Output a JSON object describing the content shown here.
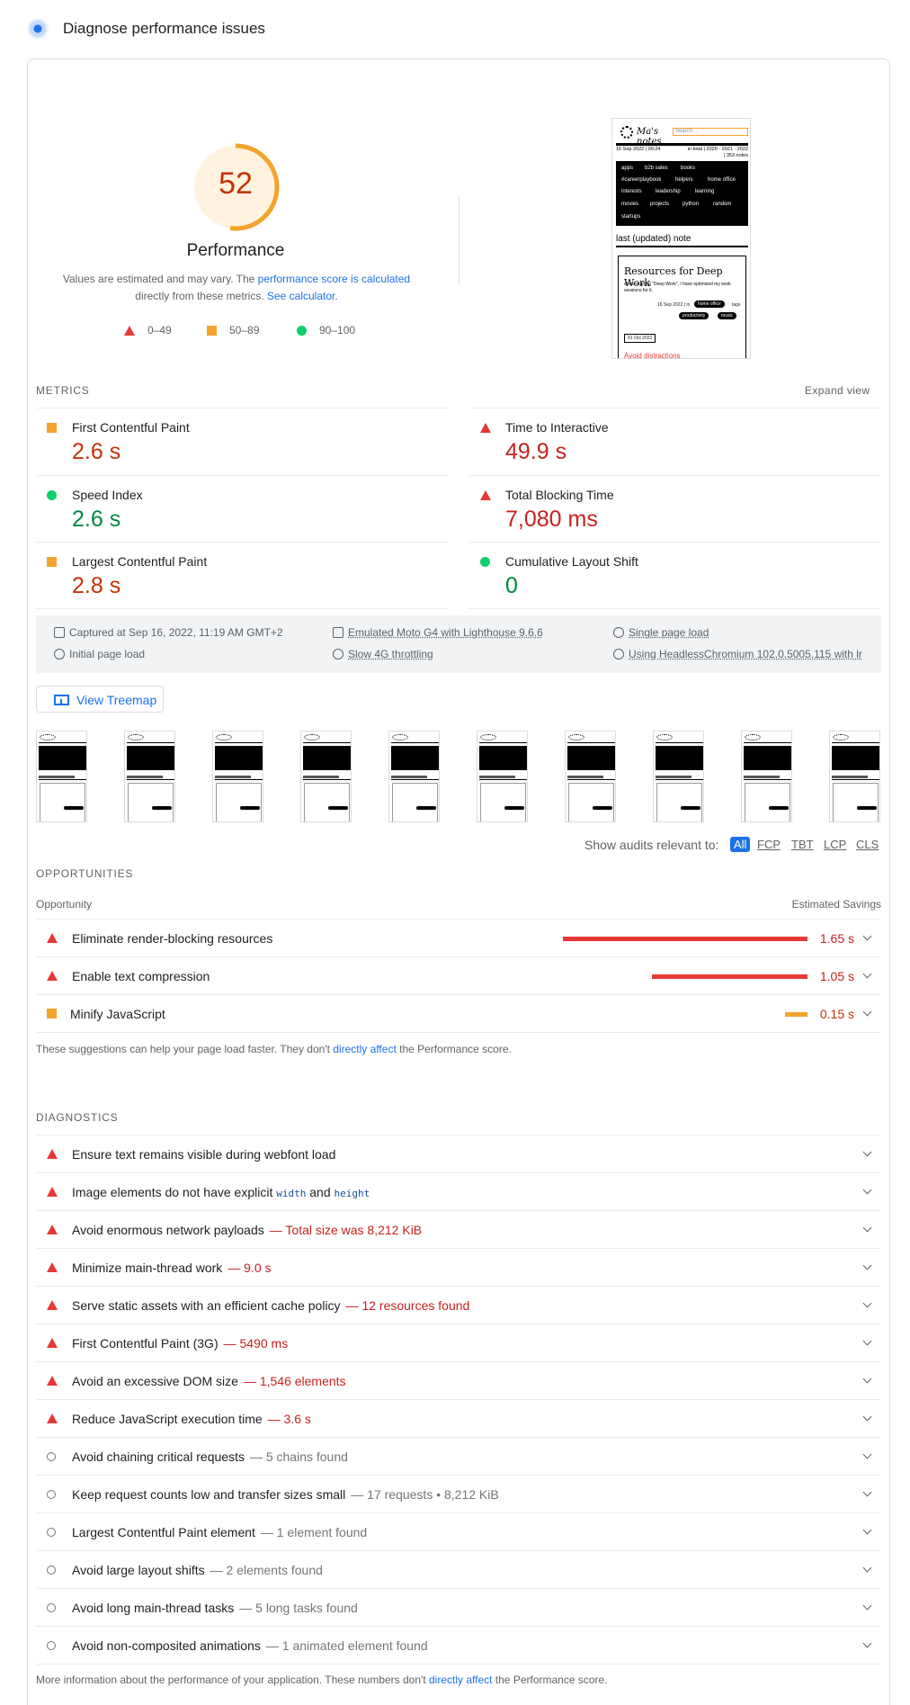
{
  "header": {
    "title": "Diagnose performance issues"
  },
  "score": {
    "value": 52,
    "fraction": 0.52,
    "label": "Performance",
    "color": "#c33300",
    "arc_color": "#f4a32d"
  },
  "description": {
    "prefix": "Values are estimated and may vary. The ",
    "link1": "performance score is calculated",
    "middle": " directly from these metrics. ",
    "link2": "See calculator."
  },
  "legend": [
    {
      "shape": "triangle",
      "color": "#e53935",
      "label": "0–49"
    },
    {
      "shape": "square",
      "color": "#f4a32d",
      "label": "50–89"
    },
    {
      "shape": "circle",
      "color": "#0cce6b",
      "label": "90–100"
    }
  ],
  "screenshot": {
    "search_placeholder": "Search...",
    "date_left": "16 Sep 2022 | 09:24",
    "date_right": "in total | 2020 · 2021 · 2022",
    "date_right2": "| 353 notes",
    "nav": [
      "apps",
      "b2b sales",
      "books",
      "#careerplaybook",
      "helpers",
      "home office",
      "interests",
      "leadership",
      "learning",
      "movies",
      "projects",
      "python",
      "random",
      "startups"
    ],
    "section": "last (updated) note",
    "article_title": "Resources for Deep Work",
    "article_text": "since reading \"Deep Work\", I have optimized my work sessions for it.",
    "article_date": "16 Sep 2022 | in",
    "tag1": "home office",
    "tags_label": "tags",
    "tag2": "productivity",
    "tag3": "music",
    "datebox": "01 Oct 2022",
    "red_text": "Avoid distractions"
  },
  "metrics_section": {
    "title": "METRICS",
    "expand": "Expand view"
  },
  "metrics": [
    {
      "name": "First Contentful Paint",
      "value": "2.6 s",
      "rating": "average",
      "color": "#c33300"
    },
    {
      "name": "Time to Interactive",
      "value": "49.9 s",
      "rating": "fail",
      "color": "#c5221f"
    },
    {
      "name": "Speed Index",
      "value": "2.6 s",
      "rating": "pass",
      "color": "#018642"
    },
    {
      "name": "Total Blocking Time",
      "value": "7,080 ms",
      "rating": "fail",
      "color": "#c5221f"
    },
    {
      "name": "Largest Contentful Paint",
      "value": "2.8 s",
      "rating": "average",
      "color": "#c33300"
    },
    {
      "name": "Cumulative Layout Shift",
      "value": "0",
      "rating": "pass",
      "color": "#018642"
    }
  ],
  "info": {
    "captured": "Captured at Sep 16, 2022, 11:19 AM GMT+2",
    "device": "Emulated Moto G4 with Lighthouse 9.6.6",
    "load": "Single page load",
    "initial": "Initial page load",
    "throttling": "Slow 4G throttling",
    "browser": "Using HeadlessChromium 102.0.5005.115 with lr"
  },
  "treemap": {
    "label": "View Treemap"
  },
  "filter": {
    "label": "Show audits relevant to:",
    "chips": [
      "All",
      "FCP",
      "TBT",
      "LCP",
      "CLS"
    ]
  },
  "opportunities": {
    "title": "OPPORTUNITIES",
    "col_left": "Opportunity",
    "col_right": "Estimated Savings",
    "items": [
      {
        "name": "Eliminate render-blocking resources",
        "savings": "1.65 s",
        "savings_s": 1.65,
        "rating": "fail"
      },
      {
        "name": "Enable text compression",
        "savings": "1.05 s",
        "savings_s": 1.05,
        "rating": "fail"
      },
      {
        "name": "Minify JavaScript",
        "savings": "0.15 s",
        "savings_s": 0.15,
        "rating": "average"
      }
    ],
    "note_prefix": "These suggestions can help your page load faster. They don't ",
    "note_link": "directly affect",
    "note_suffix": " the Performance score."
  },
  "diagnostics": {
    "title": "DIAGNOSTICS",
    "items": [
      {
        "name": "Ensure text remains visible during webfont load",
        "display": "",
        "rating": "fail"
      },
      {
        "name": "Image elements do not have explicit",
        "code1": "width",
        "and": "and",
        "code2": "height",
        "display": "",
        "rating": "fail"
      },
      {
        "name": "Avoid enormous network payloads",
        "display": "— Total size was 8,212 KiB",
        "rating": "fail"
      },
      {
        "name": "Minimize main-thread work",
        "display": "— 9.0 s",
        "rating": "fail"
      },
      {
        "name": "Serve static assets with an efficient cache policy",
        "display": "— 12 resources found",
        "rating": "fail"
      },
      {
        "name": "First Contentful Paint (3G)",
        "display": "— 5490 ms",
        "rating": "fail"
      },
      {
        "name": "Avoid an excessive DOM size",
        "display": "— 1,546 elements",
        "rating": "fail"
      },
      {
        "name": "Reduce JavaScript execution time",
        "display": "— 3.6 s",
        "rating": "fail"
      },
      {
        "name": "Avoid chaining critical requests",
        "display": "— 5 chains found",
        "rating": "info"
      },
      {
        "name": "Keep request counts low and transfer sizes small",
        "display": "— 17 requests • 8,212 KiB",
        "rating": "info"
      },
      {
        "name": "Largest Contentful Paint element",
        "display": "— 1 element found",
        "rating": "info"
      },
      {
        "name": "Avoid large layout shifts",
        "display": "— 2 elements found",
        "rating": "info"
      },
      {
        "name": "Avoid long main-thread tasks",
        "display": "— 5 long tasks found",
        "rating": "info"
      },
      {
        "name": "Avoid non-composited animations",
        "display": "— 1 animated element found",
        "rating": "info"
      }
    ],
    "note_prefix": "More information about the performance of your application. These numbers don't ",
    "note_link": "directly affect",
    "note_suffix": " the Performance score."
  }
}
